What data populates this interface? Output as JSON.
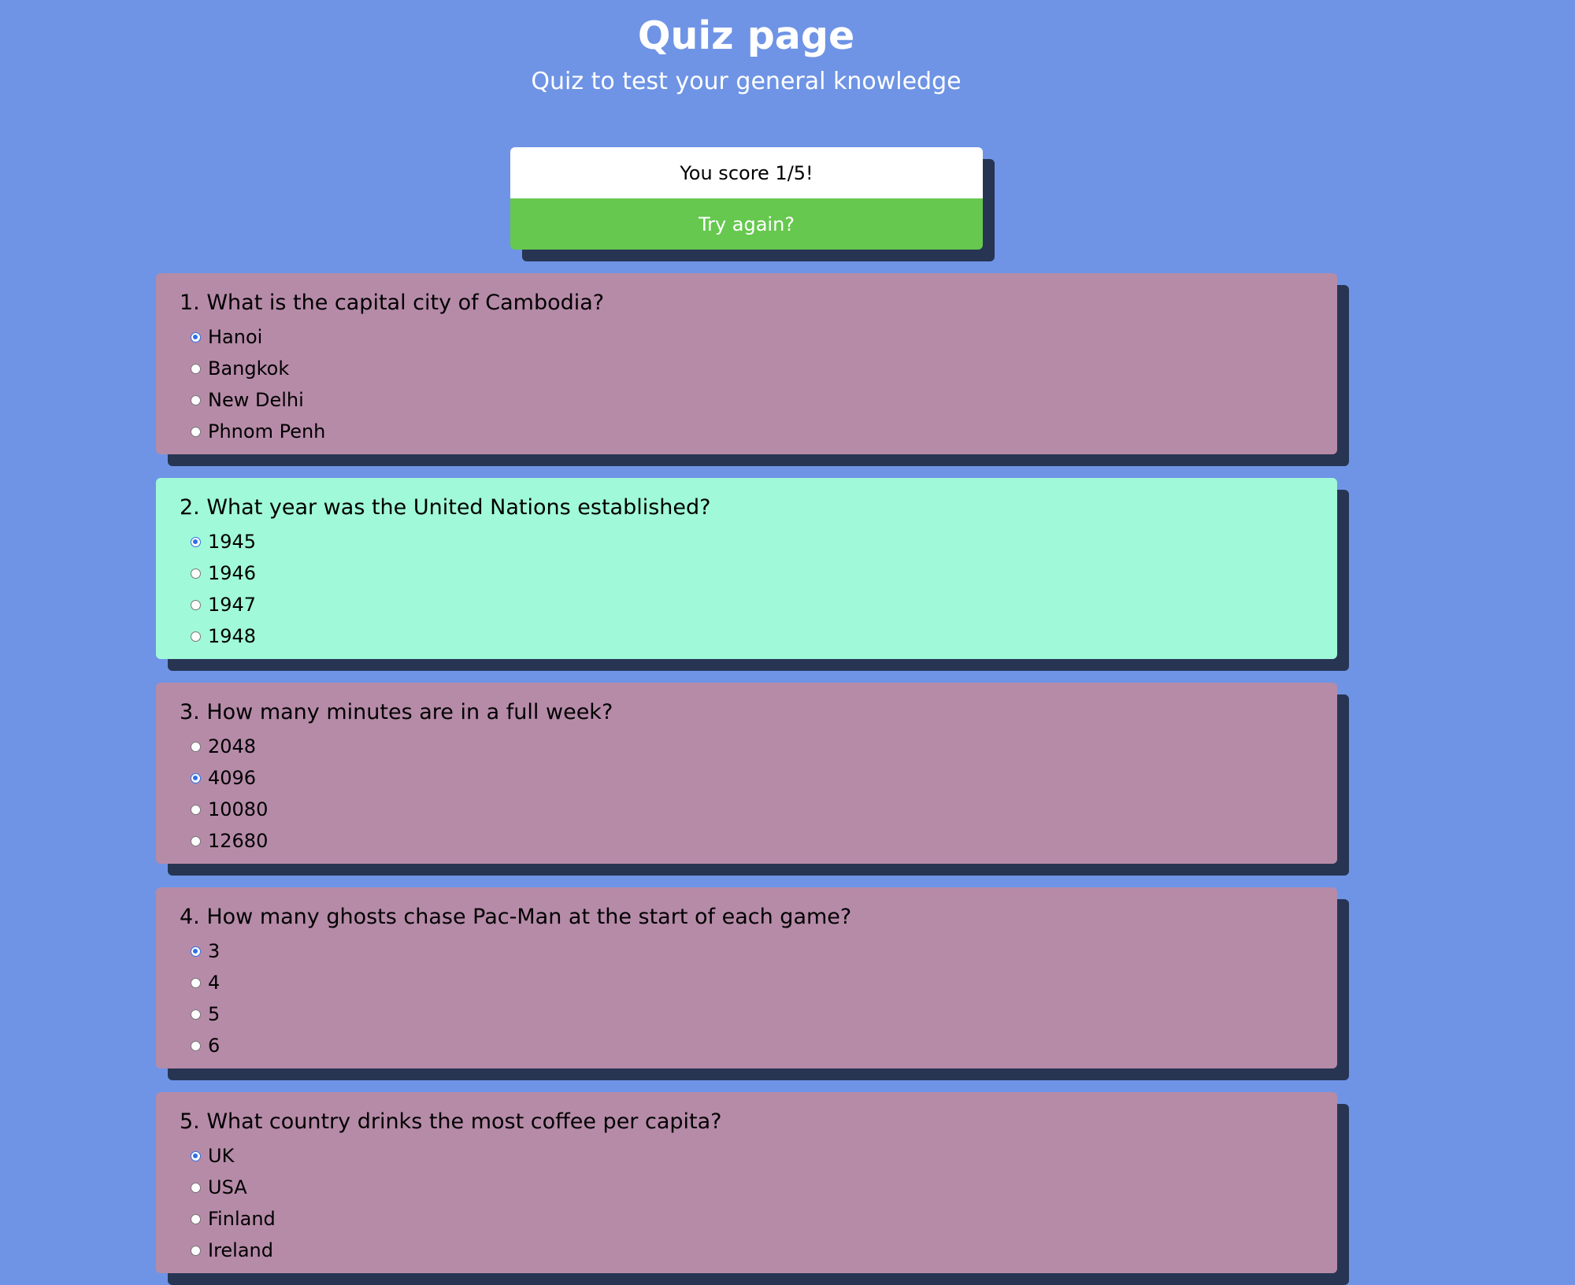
{
  "page": {
    "title": "Quiz page",
    "subtitle": "Quiz to test your general knowledge",
    "background_color": "#6f94e5"
  },
  "score": {
    "text": "You score 1/5!",
    "retry_label": "Try again?",
    "retry_color": "#66c84e"
  },
  "colors": {
    "incorrect_card": "#b68ba8",
    "correct_card": "#a0f9d8",
    "shadow": "#273553",
    "radio_selected": "#2f6fe6"
  },
  "questions": [
    {
      "text": "1. What is the capital city of Cambodia?",
      "status": "incorrect",
      "options": [
        "Hanoi",
        "Bangkok",
        "New Delhi",
        "Phnom Penh"
      ],
      "selected_index": 0
    },
    {
      "text": "2. What year was the United Nations established?",
      "status": "correct",
      "options": [
        "1945",
        "1946",
        "1947",
        "1948"
      ],
      "selected_index": 0
    },
    {
      "text": "3. How many minutes are in a full week?",
      "status": "incorrect",
      "options": [
        "2048",
        "4096",
        "10080",
        "12680"
      ],
      "selected_index": 1
    },
    {
      "text": "4. How many ghosts chase Pac-Man at the start of each game?",
      "status": "incorrect",
      "options": [
        "3",
        "4",
        "5",
        "6"
      ],
      "selected_index": 0
    },
    {
      "text": "5. What country drinks the most coffee per capita?",
      "status": "incorrect",
      "options": [
        "UK",
        "USA",
        "Finland",
        "Ireland"
      ],
      "selected_index": 0
    }
  ]
}
